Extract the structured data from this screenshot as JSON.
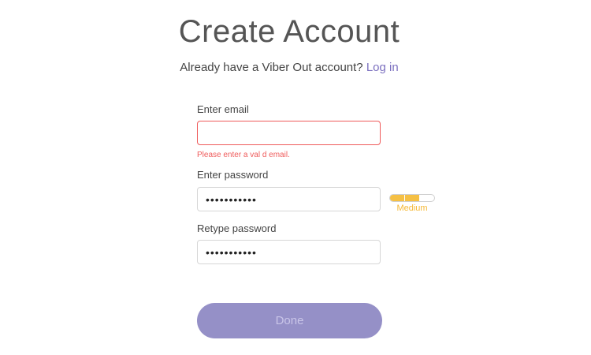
{
  "header": {
    "title": "Create Account",
    "subtitle_text": "Already have a Viber Out account?",
    "login_link": "Log in"
  },
  "form": {
    "email": {
      "label": "Enter email",
      "value": "",
      "error": "Please enter a val d email."
    },
    "password": {
      "label": "Enter password",
      "value": "•••••••••••",
      "strength_label": "Medium",
      "strength_level": 0.66,
      "strength_color": "#f5c044"
    },
    "retype": {
      "label": "Retype password",
      "value": "•••••••••••"
    }
  },
  "actions": {
    "done_label": "Done",
    "done_color": "#9590c7"
  }
}
